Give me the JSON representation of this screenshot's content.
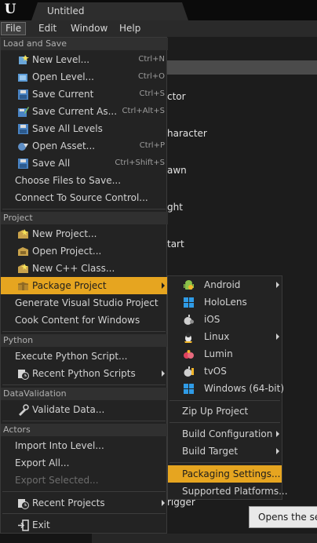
{
  "window": {
    "doc_tab_title": "Untitled",
    "logo_text": "U"
  },
  "menubar": {
    "file": "File",
    "edit": "Edit",
    "window": "Window",
    "help": "Help"
  },
  "file_menu": {
    "sections": {
      "load_and_save": "Load and Save",
      "project": "Project",
      "python": "Python",
      "data_validation": "DataValidation",
      "actors": "Actors"
    },
    "items": {
      "new_level": {
        "label": "New Level...",
        "shortcut": "Ctrl+N",
        "icon": "new-level-icon"
      },
      "open_level": {
        "label": "Open Level...",
        "shortcut": "Ctrl+O",
        "icon": "open-level-icon"
      },
      "save_current": {
        "label": "Save Current",
        "shortcut": "Ctrl+S",
        "icon": "save-icon"
      },
      "save_current_as": {
        "label": "Save Current As...",
        "shortcut": "Ctrl+Alt+S",
        "icon": "save-as-icon"
      },
      "save_all_levels": {
        "label": "Save All Levels",
        "icon": "save-icon"
      },
      "open_asset": {
        "label": "Open Asset...",
        "shortcut": "Ctrl+P",
        "icon": "open-asset-icon"
      },
      "save_all": {
        "label": "Save All",
        "shortcut": "Ctrl+Shift+S",
        "icon": "save-icon"
      },
      "choose_files": {
        "label": "Choose Files to Save..."
      },
      "connect_source": {
        "label": "Connect To Source Control..."
      },
      "new_project": {
        "label": "New Project...",
        "icon": "new-project-icon"
      },
      "open_project": {
        "label": "Open Project...",
        "icon": "open-project-icon"
      },
      "new_cpp_class": {
        "label": "New C++ Class...",
        "icon": "new-cpp-class-icon"
      },
      "package_project": {
        "label": "Package Project",
        "icon": "package-icon"
      },
      "generate_vs": {
        "label": "Generate Visual Studio Project"
      },
      "cook_content": {
        "label": "Cook Content for Windows"
      },
      "execute_python": {
        "label": "Execute Python Script..."
      },
      "recent_python": {
        "label": "Recent Python Scripts",
        "icon": "recent-icon"
      },
      "validate_data": {
        "label": "Validate Data...",
        "icon": "validate-icon"
      },
      "import_into_level": {
        "label": "Import Into Level..."
      },
      "export_all": {
        "label": "Export All..."
      },
      "export_selected": {
        "label": "Export Selected..."
      },
      "recent_projects": {
        "label": "Recent Projects",
        "icon": "recent-icon"
      },
      "exit": {
        "label": "Exit",
        "icon": "exit-icon"
      }
    }
  },
  "package_submenu": {
    "android": "Android",
    "hololens": "HoloLens",
    "ios": "iOS",
    "linux": "Linux",
    "lumin": "Lumin",
    "tvos": "tvOS",
    "windows": "Windows (64-bit)",
    "zip_up": "Zip Up Project",
    "build_configuration": "Build Configuration",
    "build_target": "Build Target",
    "packaging_settings": "Packaging Settings...",
    "supported_platforms": "Supported Platforms..."
  },
  "background": {
    "text1": "ctor",
    "text2": "haracter",
    "text3": "awn",
    "text4": "ght",
    "text5": "tart",
    "text6": "rigger"
  },
  "tooltip": {
    "text": "Opens the settings"
  },
  "colors": {
    "highlight": "#e6a520",
    "menu_bg": "#232323",
    "menubar_bg": "#2a2a2a"
  }
}
